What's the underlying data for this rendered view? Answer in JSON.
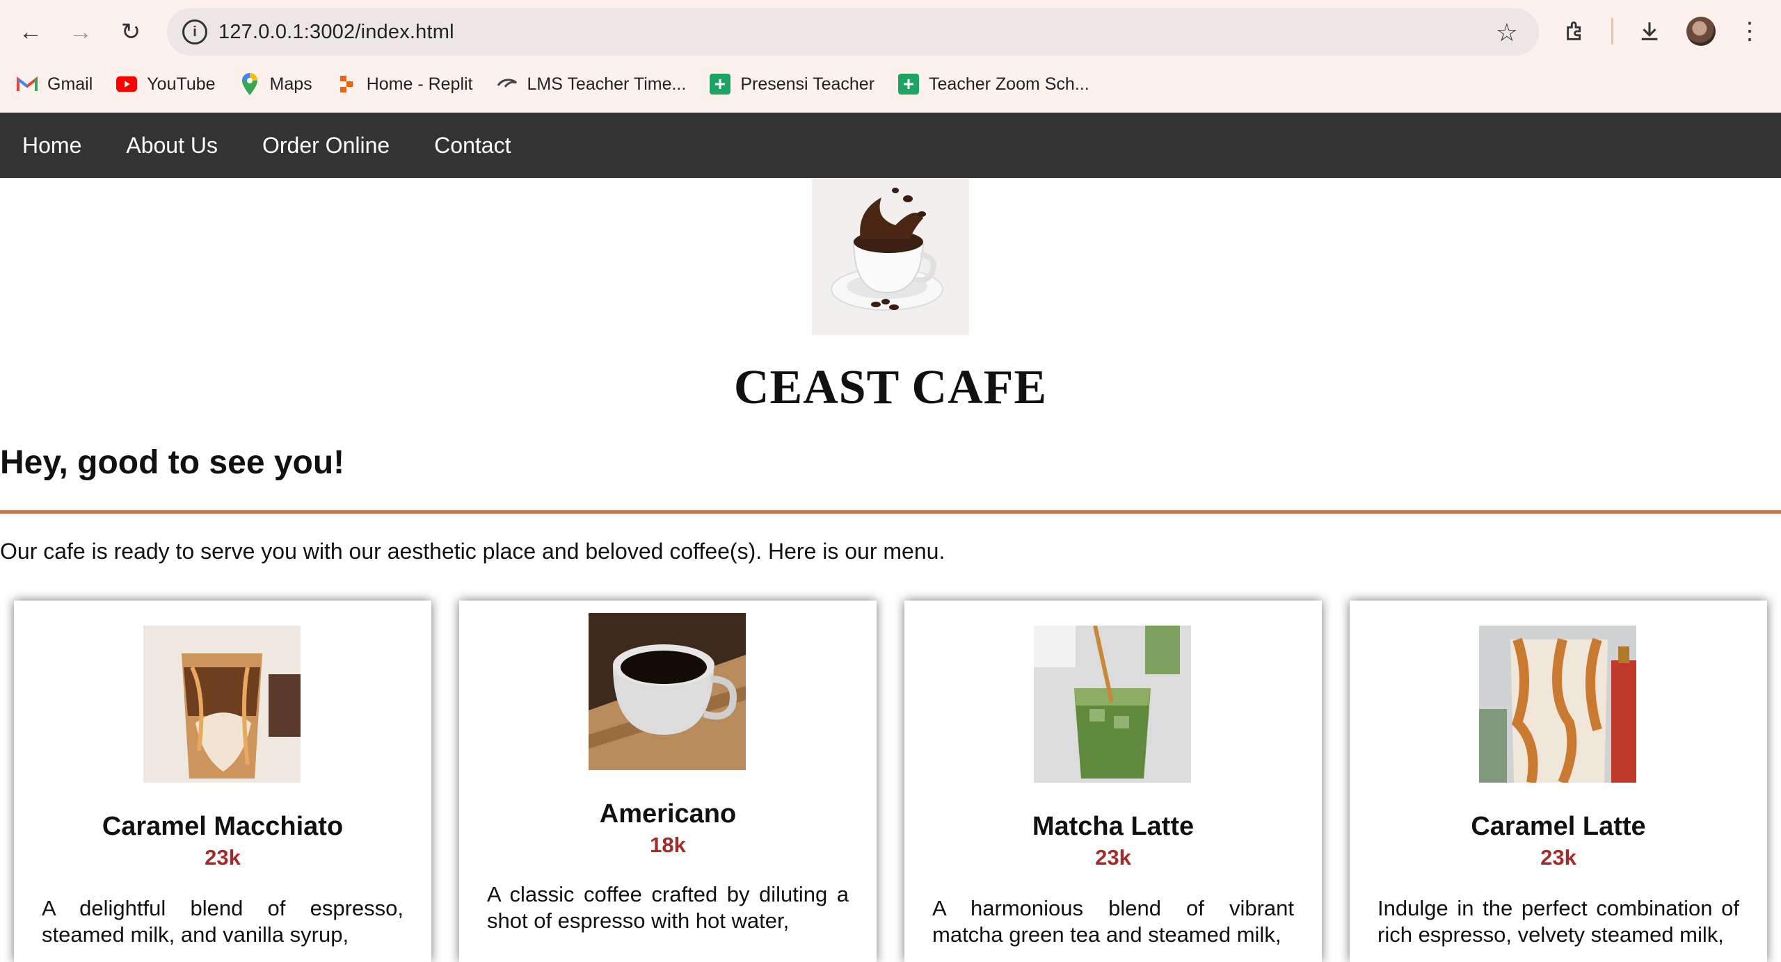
{
  "browser": {
    "url": "127.0.0.1:3002/index.html",
    "bookmarks": [
      {
        "label": "Gmail",
        "icon": "gmail-icon"
      },
      {
        "label": "YouTube",
        "icon": "youtube-icon"
      },
      {
        "label": "Maps",
        "icon": "maps-icon"
      },
      {
        "label": "Home - Replit",
        "icon": "replit-icon"
      },
      {
        "label": "LMS Teacher Time...",
        "icon": "lms-icon"
      },
      {
        "label": "Presensi Teacher",
        "icon": "sheets-icon"
      },
      {
        "label": "Teacher Zoom Sch...",
        "icon": "sheets-icon"
      }
    ]
  },
  "nav": {
    "items": [
      "Home",
      "About Us",
      "Order Online",
      "Contact"
    ]
  },
  "brand": "CEAST CAFE",
  "greeting": "Hey, good to see you!",
  "intro": "Our cafe is ready to serve you with our aesthetic place and beloved coffee(s). Here is our menu.",
  "menu": [
    {
      "name": "Caramel Macchiato",
      "price": "23k",
      "desc": "A delightful blend of espresso, steamed milk, and vanilla syrup,"
    },
    {
      "name": "Americano",
      "price": "18k",
      "desc": "A classic coffee crafted by diluting a shot of espresso with hot water,"
    },
    {
      "name": "Matcha Latte",
      "price": "23k",
      "desc": "A harmonious blend of vibrant matcha green tea and steamed milk,"
    },
    {
      "name": "Caramel Latte",
      "price": "23k",
      "desc": "Indulge in the perfect combination of rich espresso, velvety steamed milk,"
    }
  ],
  "colors": {
    "nav_bg": "#333333",
    "divider": "#c47a50",
    "price": "#a52a2a",
    "chrome_bg": "#fdf1ee"
  }
}
